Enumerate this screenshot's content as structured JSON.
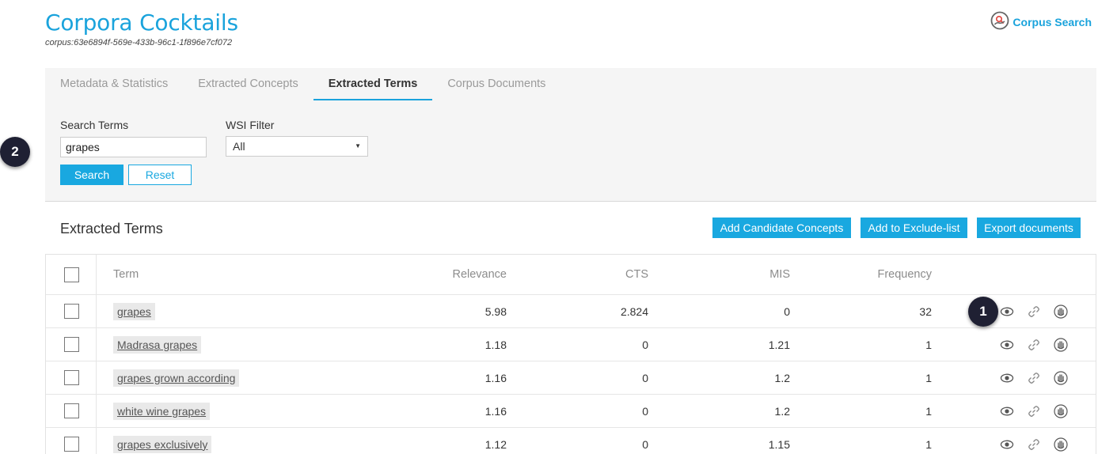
{
  "header": {
    "title": "Corpora Cocktails",
    "corpus_id": "corpus:63e6894f-569e-433b-96c1-1f896e7cf072",
    "corpus_search_label": "Corpus Search"
  },
  "tabs": [
    {
      "label": "Metadata & Statistics"
    },
    {
      "label": "Extracted Concepts"
    },
    {
      "label": "Extracted Terms"
    },
    {
      "label": "Corpus Documents"
    }
  ],
  "active_tab": "Extracted Terms",
  "filters": {
    "search_label": "Search Terms",
    "search_value": "grapes",
    "wsi_label": "WSI Filter",
    "wsi_value": "All",
    "search_button": "Search",
    "reset_button": "Reset"
  },
  "section": {
    "title": "Extracted Terms",
    "buttons": {
      "add_candidate": "Add Candidate Concepts",
      "add_exclude": "Add to Exclude-list",
      "export": "Export documents"
    }
  },
  "table": {
    "columns": [
      "Term",
      "Relevance",
      "CTS",
      "MIS",
      "Frequency"
    ],
    "rows": [
      {
        "term": "grapes",
        "relevance": "5.98",
        "cts": "2.824",
        "mis": "0",
        "frequency": "32"
      },
      {
        "term": "Madrasa grapes",
        "relevance": "1.18",
        "cts": "0",
        "mis": "1.21",
        "frequency": "1"
      },
      {
        "term": "grapes grown according",
        "relevance": "1.16",
        "cts": "0",
        "mis": "1.2",
        "frequency": "1"
      },
      {
        "term": "white wine grapes",
        "relevance": "1.16",
        "cts": "0",
        "mis": "1.2",
        "frequency": "1"
      },
      {
        "term": "grapes exclusively",
        "relevance": "1.12",
        "cts": "0",
        "mis": "1.15",
        "frequency": "1"
      }
    ]
  },
  "badges": {
    "one": "1",
    "two": "2"
  },
  "colors": {
    "accent": "#1aa3dc",
    "button": "#19a8e0",
    "badge": "#1f2033"
  }
}
